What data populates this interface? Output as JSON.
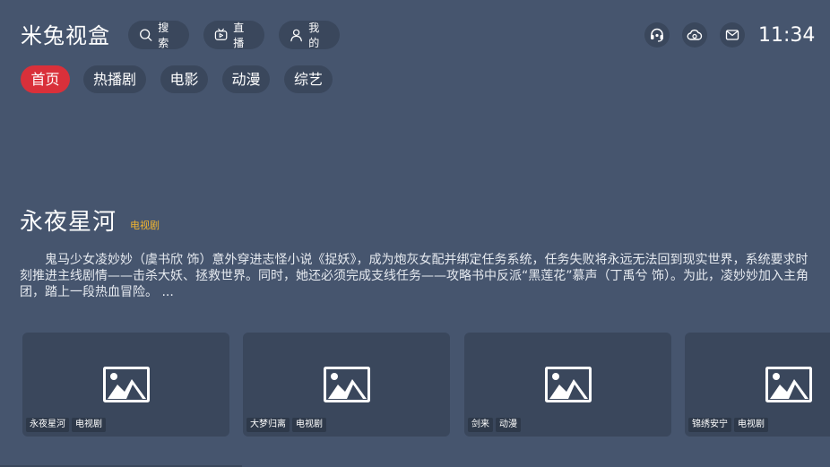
{
  "app": {
    "title": "米兔视盒"
  },
  "header": {
    "nav": [
      {
        "label": "搜索",
        "icon": "search-icon"
      },
      {
        "label": "直播",
        "icon": "tv-icon"
      },
      {
        "label": "我的",
        "icon": "user-icon"
      }
    ],
    "actions": [
      {
        "icon": "headset-icon"
      },
      {
        "icon": "cloud-icon"
      },
      {
        "icon": "mail-icon"
      }
    ],
    "clock": "11:34"
  },
  "tabs": [
    {
      "label": "首页",
      "active": true
    },
    {
      "label": "热播剧",
      "active": false
    },
    {
      "label": "电影",
      "active": false
    },
    {
      "label": "动漫",
      "active": false
    },
    {
      "label": "综艺",
      "active": false
    }
  ],
  "featured": {
    "title": "永夜星河",
    "tag": "电视剧",
    "description": "鬼马少女凌妙妙（虞书欣 饰）意外穿进志怪小说《捉妖》，成为炮灰女配并绑定任务系统，任务失败将永远无法回到现实世界，系统要求时刻推进主线剧情——击杀大妖、拯救世界。同时，她还必须完成支线任务——攻略书中反派“黑莲花”慕声（丁禹兮 饰）。为此，凌妙妙加入主角团，踏上一段热血冒险。 ..."
  },
  "cards": [
    {
      "name": "永夜星河",
      "category": "电视剧"
    },
    {
      "name": "大梦归离",
      "category": "电视剧"
    },
    {
      "name": "剑来",
      "category": "动漫"
    },
    {
      "name": "锦绣安宁",
      "category": "电视剧"
    }
  ],
  "colors": {
    "background": "#46556e",
    "button_bg": "#3a475c",
    "active_tab": "#d9303a",
    "tag_accent": "#f2b52f"
  }
}
